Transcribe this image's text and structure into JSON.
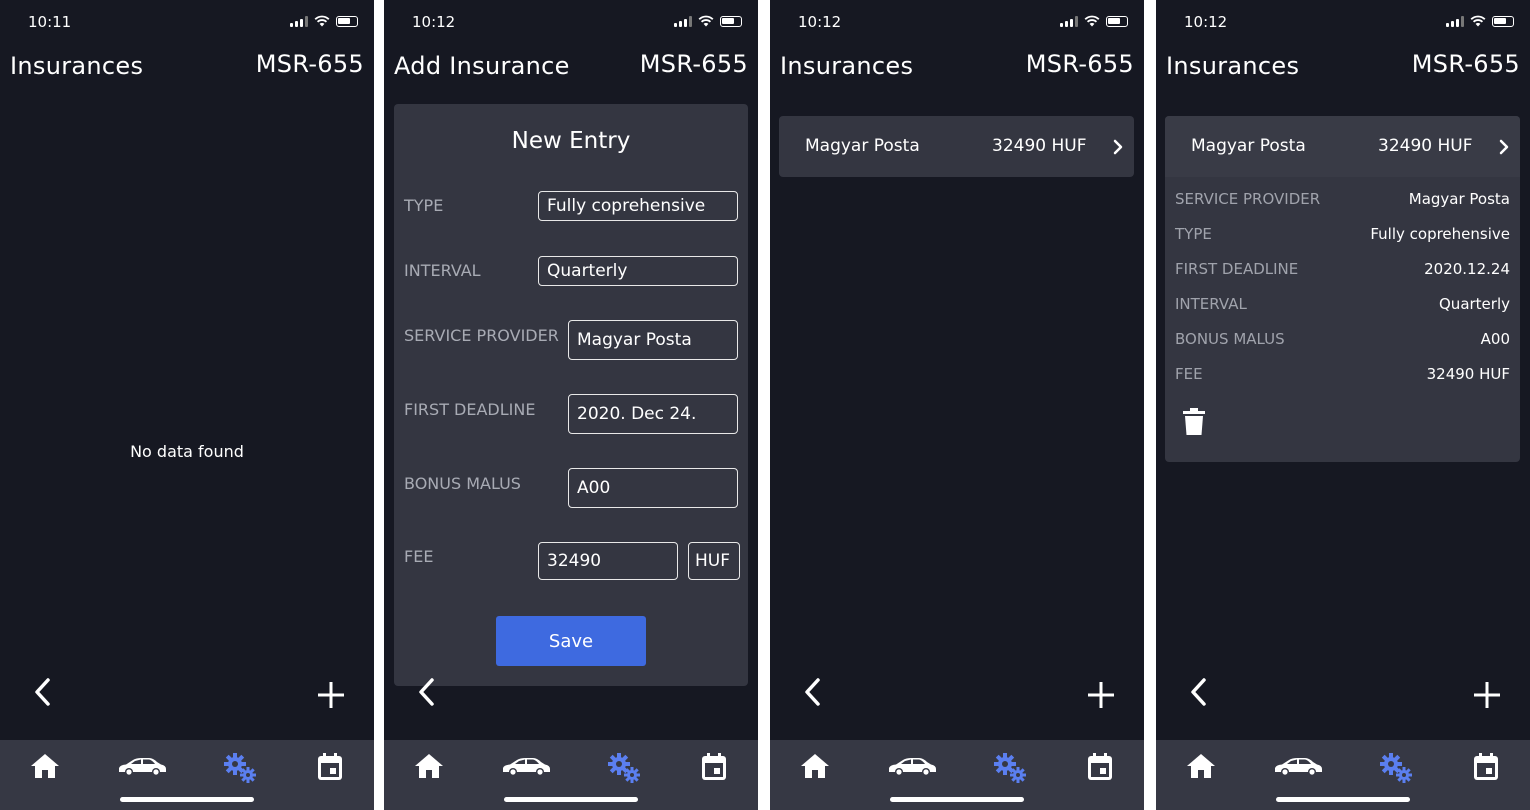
{
  "screens": [
    {
      "time": "10:11",
      "title": "Insurances",
      "plate": "MSR-655",
      "empty_text": "No data found"
    },
    {
      "time": "10:12",
      "title": "Add Insurance",
      "plate": "MSR-655",
      "form": {
        "heading": "New Entry",
        "type_label": "TYPE",
        "type_value": "Fully coprehensive",
        "interval_label": "INTERVAL",
        "interval_value": "Quarterly",
        "provider_label": "SERVICE PROVIDER",
        "provider_value": "Magyar Posta",
        "deadline_label": "FIRST DEADLINE",
        "deadline_value": "2020. Dec 24.",
        "bonus_label": "BONUS MALUS",
        "bonus_value": "A00",
        "fee_label": "FEE",
        "fee_value": "32490",
        "currency": "HUF",
        "save_label": "Save"
      }
    },
    {
      "time": "10:12",
      "title": "Insurances",
      "plate": "MSR-655",
      "item": {
        "name": "Magyar Posta",
        "fee": "32490 HUF"
      }
    },
    {
      "time": "10:12",
      "title": "Insurances",
      "plate": "MSR-655",
      "item": {
        "name": "Magyar Posta",
        "fee": "32490 HUF"
      },
      "details": [
        {
          "label": "SERVICE PROVIDER",
          "value": "Magyar Posta"
        },
        {
          "label": "TYPE",
          "value": "Fully coprehensive"
        },
        {
          "label": "FIRST DEADLINE",
          "value": "2020.12.24"
        },
        {
          "label": "INTERVAL",
          "value": "Quarterly"
        },
        {
          "label": "BONUS MALUS",
          "value": "A00"
        },
        {
          "label": "FEE",
          "value": "32490 HUF"
        }
      ]
    }
  ],
  "tabs": [
    "home-icon",
    "car-icon",
    "settings-gears-icon",
    "calendar-icon"
  ],
  "colors": {
    "background": "#161822",
    "card": "#343641",
    "tabbar": "#363844",
    "accent": "#3e6ae0",
    "active_tab": "#5b7ff0"
  }
}
